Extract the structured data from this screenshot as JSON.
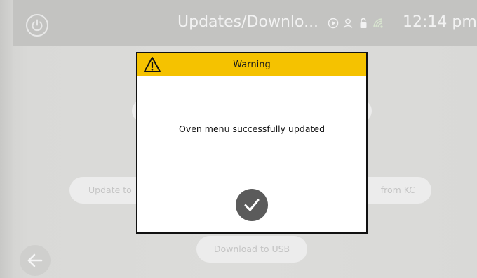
{
  "header": {
    "title": "Updates/Downlo...",
    "time": "12:14 pm",
    "icons": [
      "power-icon",
      "play-circle-icon",
      "user-icon",
      "lock-icon",
      "wifi-icon"
    ]
  },
  "background": {
    "update_to_label": "Update to",
    "from_kc_label": "from KC",
    "download_usb_label": "Download to USB",
    "back_icon": "back-arrow-icon"
  },
  "dialog": {
    "title": "Warning",
    "icon": "warning-icon",
    "message": "Oven menu successfully updated",
    "confirm_icon": "checkmark-icon"
  },
  "colors": {
    "warning_header": "#f5c200",
    "dialog_border": "#111111",
    "confirm_button": "#5b5b5b",
    "header_bar": "#c3c3c1"
  }
}
